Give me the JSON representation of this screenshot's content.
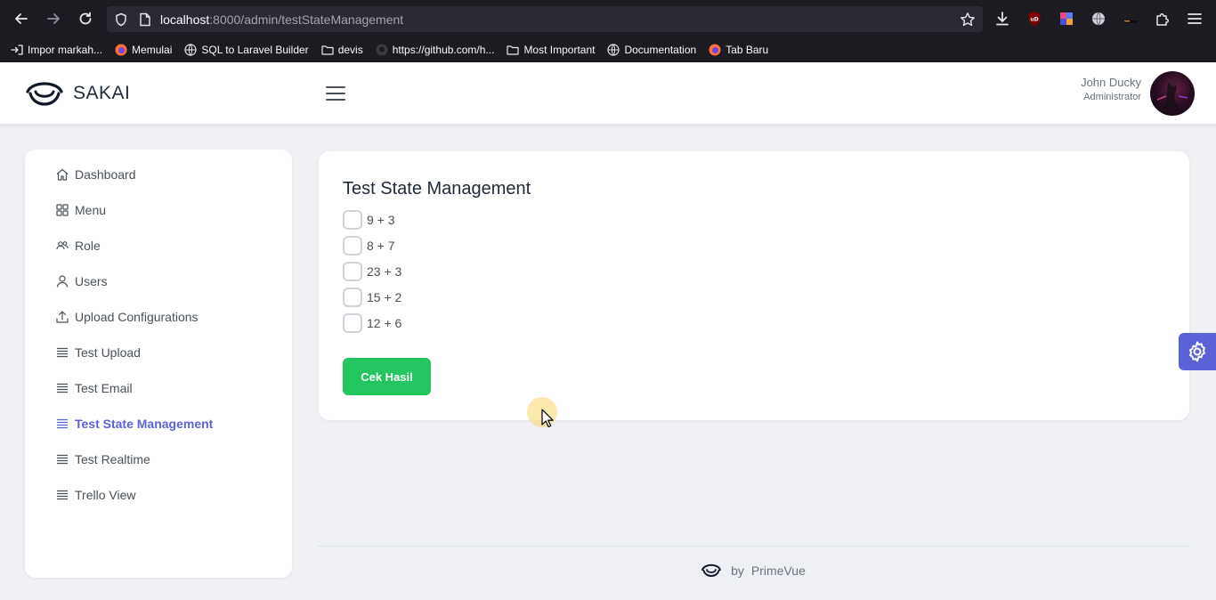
{
  "browser": {
    "url_host": "localhost",
    "url_path": ":8000/admin/testStateManagement",
    "bookmarks": [
      "Impor markah...",
      "Memulai",
      "SQL to Laravel Builder",
      "devis",
      "https://github.com/h...",
      "Most Important",
      "Documentation",
      "Tab Baru"
    ]
  },
  "header": {
    "brand": "SAKAI",
    "user_name": "John Ducky",
    "user_role": "Administrator"
  },
  "sidebar": {
    "items": [
      {
        "label": "Dashboard",
        "icon": "home-icon"
      },
      {
        "label": "Menu",
        "icon": "th-large-icon"
      },
      {
        "label": "Role",
        "icon": "users-icon"
      },
      {
        "label": "Users",
        "icon": "user-icon"
      },
      {
        "label": "Upload Configurations",
        "icon": "upload-icon"
      },
      {
        "label": "Test Upload",
        "icon": "list-icon"
      },
      {
        "label": "Test Email",
        "icon": "list-icon"
      },
      {
        "label": "Test State Management",
        "icon": "list-icon"
      },
      {
        "label": "Test Realtime",
        "icon": "list-icon"
      },
      {
        "label": "Trello View",
        "icon": "list-icon"
      }
    ]
  },
  "main": {
    "title": "Test State Management",
    "checkboxes": [
      {
        "label": "9 + 3",
        "checked": false
      },
      {
        "label": "8 + 7",
        "checked": false
      },
      {
        "label": "23 + 3",
        "checked": false
      },
      {
        "label": "15 + 2",
        "checked": false
      },
      {
        "label": "12 + 6",
        "checked": false
      }
    ],
    "button_label": "Cek Hasil"
  },
  "footer": {
    "by": "by",
    "brand": "PrimeVue"
  },
  "colors": {
    "accent": "#5a62d6",
    "success": "#22c55e"
  }
}
